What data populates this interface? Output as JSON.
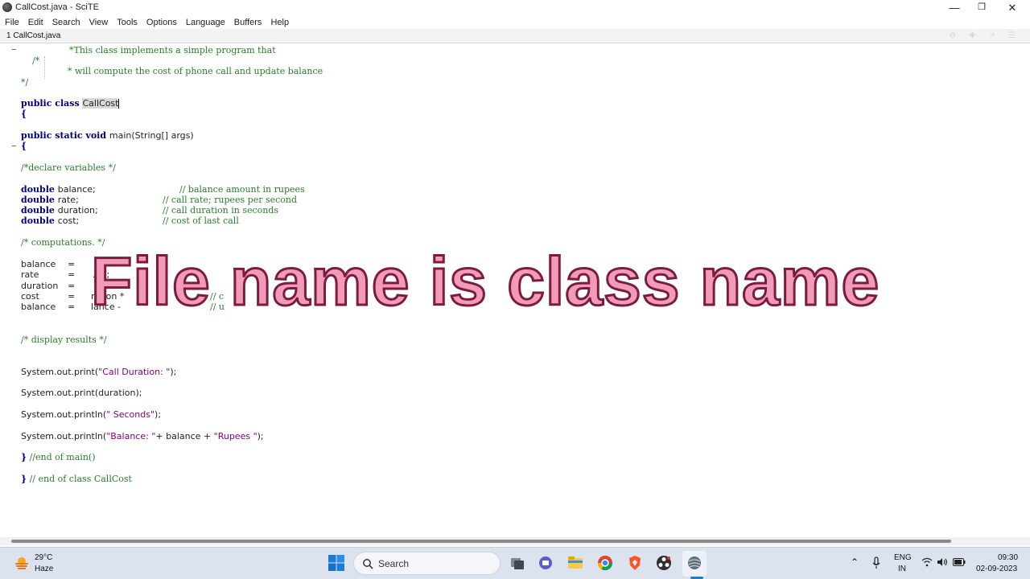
{
  "window": {
    "title": "CallCost.java - SciTE"
  },
  "menu": [
    "File",
    "Edit",
    "Search",
    "View",
    "Tools",
    "Options",
    "Language",
    "Buffers",
    "Help"
  ],
  "tab": {
    "label": "1 CallCost.java"
  },
  "code": {
    "l1": "/*",
    "l1b": "*This class implements a simple program that",
    "l2": "* will compute the cost of phone call and update balance",
    "l3": "*/",
    "class_kw": "public class ",
    "class_name": "CallCost",
    "brace_open": "{",
    "main_kw": "public static void ",
    "main_sig": "main(String[] args)",
    "brace_open2": "{",
    "c_declare": "/*declare variables */",
    "d1_kw": "double ",
    "d1": "balance;",
    "d1_c": "// balance amount in rupees",
    "d2_kw": "double ",
    "d2": "rate;",
    "d2_c": "// call rate; rupees per second",
    "d3_kw": "double ",
    "d3": "duration;",
    "d3_c": "// call duration in seconds",
    "d4_kw": "double ",
    "d4": "cost;",
    "d4_c": "// cost of last call",
    "c_comp": "/* computations. */",
    "a1": "balance",
    "a2": "rate",
    "a2v": ".02;",
    "a3": "duration",
    "a4": "cost",
    "a4v": "ration *",
    "a4c": "// c",
    "a5": "balance",
    "a5v": "lance - ",
    "a5c": "// u",
    "c_display": "/* display results */",
    "p1_pre": "System.out.print(",
    "p1_str": "\"Call Duration: \"",
    "p1_post": ");",
    "p2": "System.out.print(duration);",
    "p3_pre": "System.out.println(",
    "p3_str": "\" Seconds\"",
    "p3_post": ");",
    "p4_pre": "System.out.println(",
    "p4_str": "\"Balance: \"",
    "p4_mid": "+ balance + ",
    "p4_str2": "\"Rupees \"",
    "p4_post": ");",
    "end_main_brace": "}",
    "end_main_c": " //end of main()",
    "end_class_brace": "}",
    "end_class_c": " // end of class CallCost"
  },
  "overlay": {
    "caption": "File name is class name"
  },
  "taskbar": {
    "weather_temp": "29°C",
    "weather_desc": "Haze",
    "search_label": "Search",
    "lang_top": "ENG",
    "lang_bottom": "IN",
    "time": "09:30",
    "date": "02-09-2023"
  },
  "colors": {
    "comment": "#2a7d2a",
    "keyword": "#00007f",
    "string": "#7f007f",
    "caption_fill": "#f29ab9",
    "caption_stroke": "#7a1d3c",
    "taskbar": "#dde3ee"
  }
}
